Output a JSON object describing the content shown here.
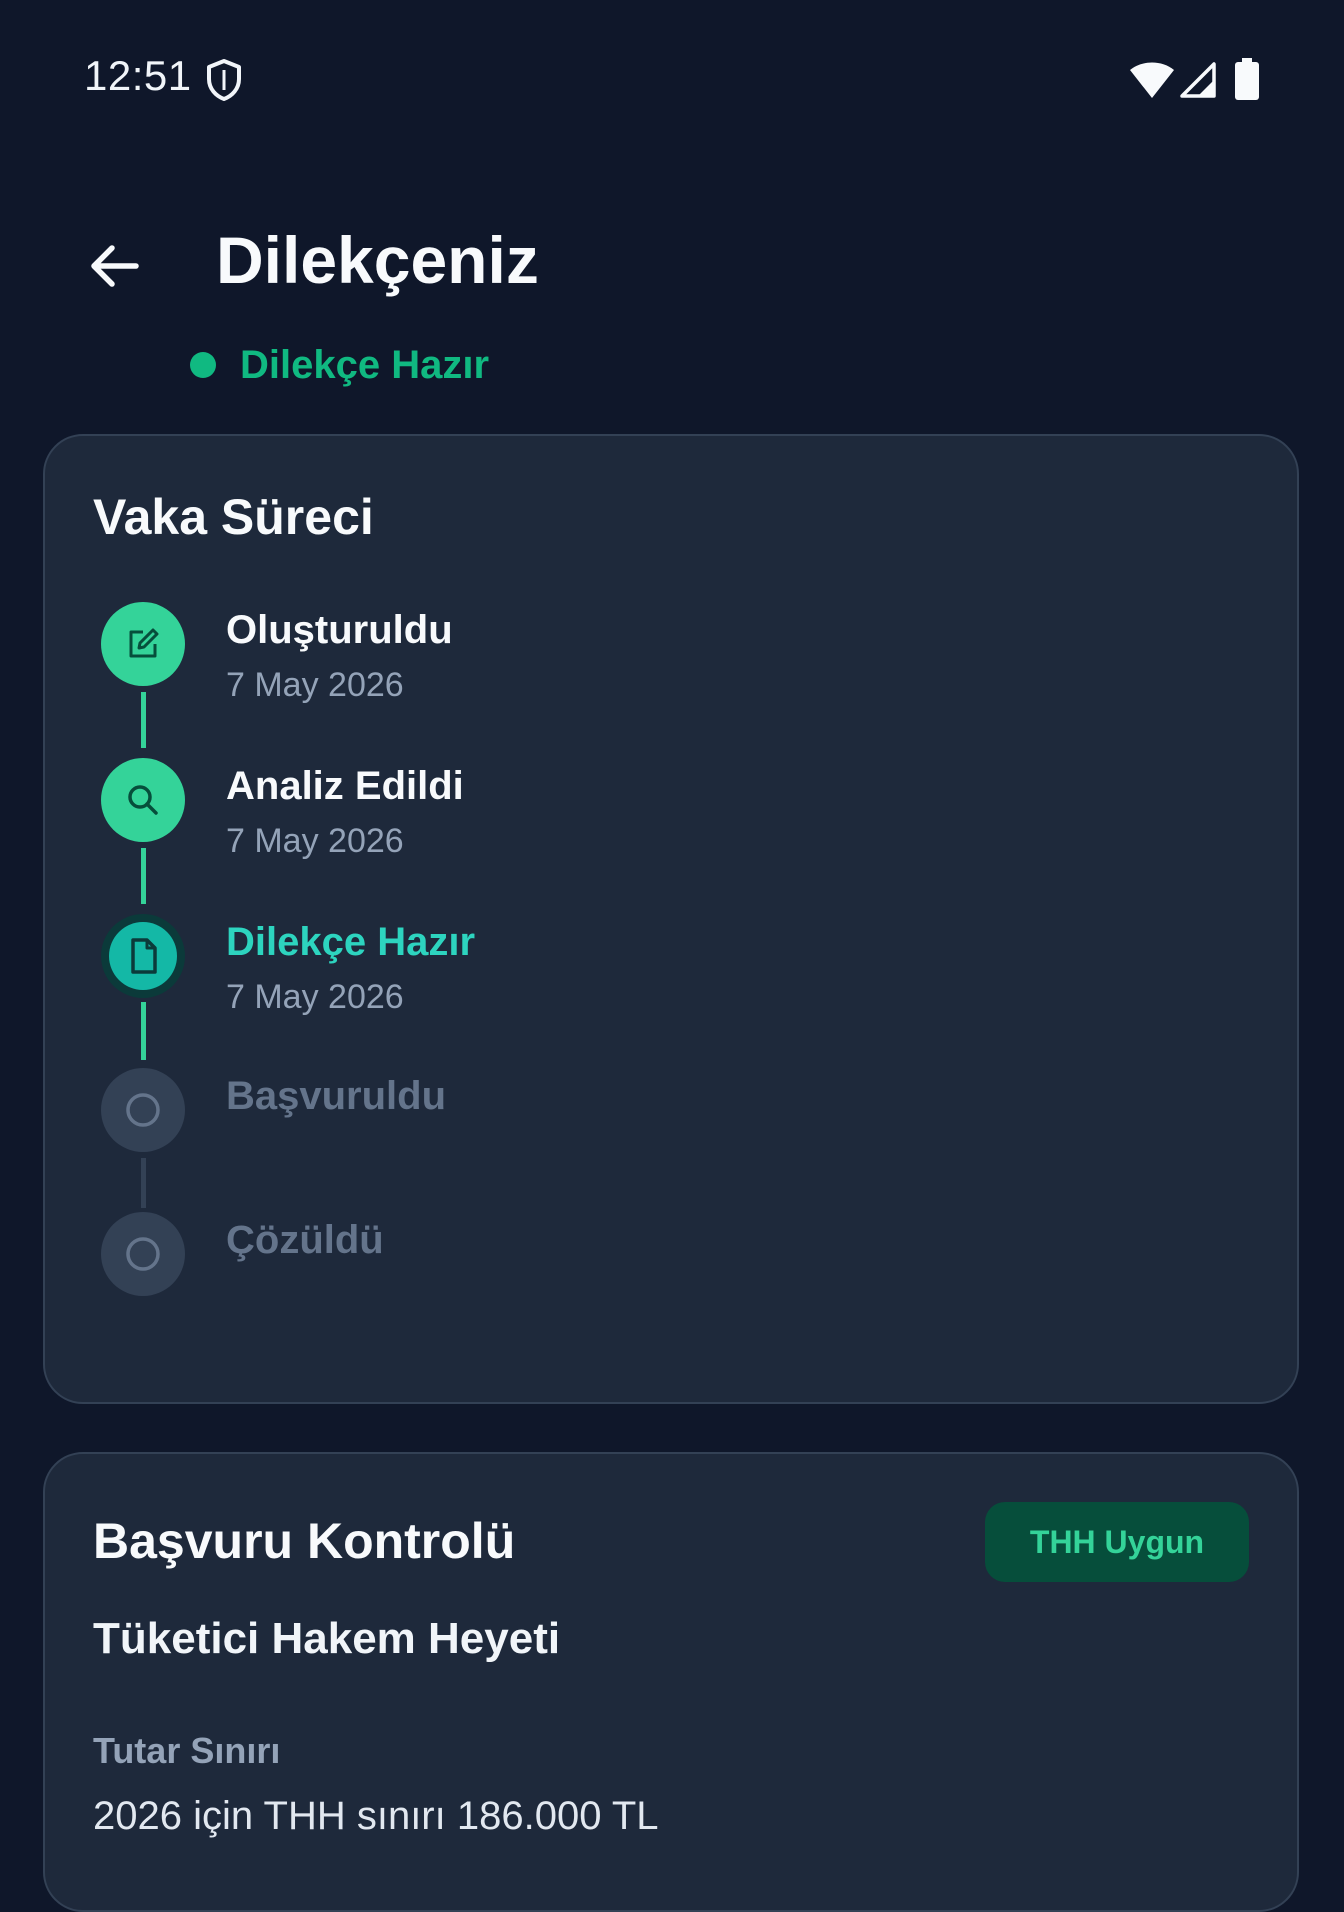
{
  "status_bar": {
    "time": "12:51",
    "icons": [
      "shield-icon",
      "wifi-icon",
      "signal-icon",
      "battery-icon"
    ]
  },
  "header": {
    "title": "Dilekçeniz",
    "status": "Dilekçe Hazır",
    "status_color": "#10b981"
  },
  "process_card": {
    "title": "Vaka Süreci",
    "steps": [
      {
        "label": "Oluşturuldu",
        "date": "7 May 2026",
        "state": "done",
        "icon": "edit-icon"
      },
      {
        "label": "Analiz Edildi",
        "date": "7 May 2026",
        "state": "done",
        "icon": "search-icon"
      },
      {
        "label": "Dilekçe Hazır",
        "date": "7 May 2026",
        "state": "current",
        "icon": "document-icon"
      },
      {
        "label": "Başvuruldu",
        "date": "",
        "state": "pending",
        "icon": "circle-icon"
      },
      {
        "label": "Çözüldü",
        "date": "",
        "state": "pending",
        "icon": "circle-icon"
      }
    ]
  },
  "check_card": {
    "title": "Başvuru Kontrolü",
    "badge": "THH Uygun",
    "subheading": "Tüketici Hakem Heyeti",
    "field_label": "Tutar Sınırı",
    "field_value": "2026 için THH sınırı 186.000 TL"
  },
  "colors": {
    "background": "#0f172a",
    "card": "#1e293b",
    "accent": "#34d399",
    "current": "#2dd4bf",
    "pending": "#64748b"
  }
}
